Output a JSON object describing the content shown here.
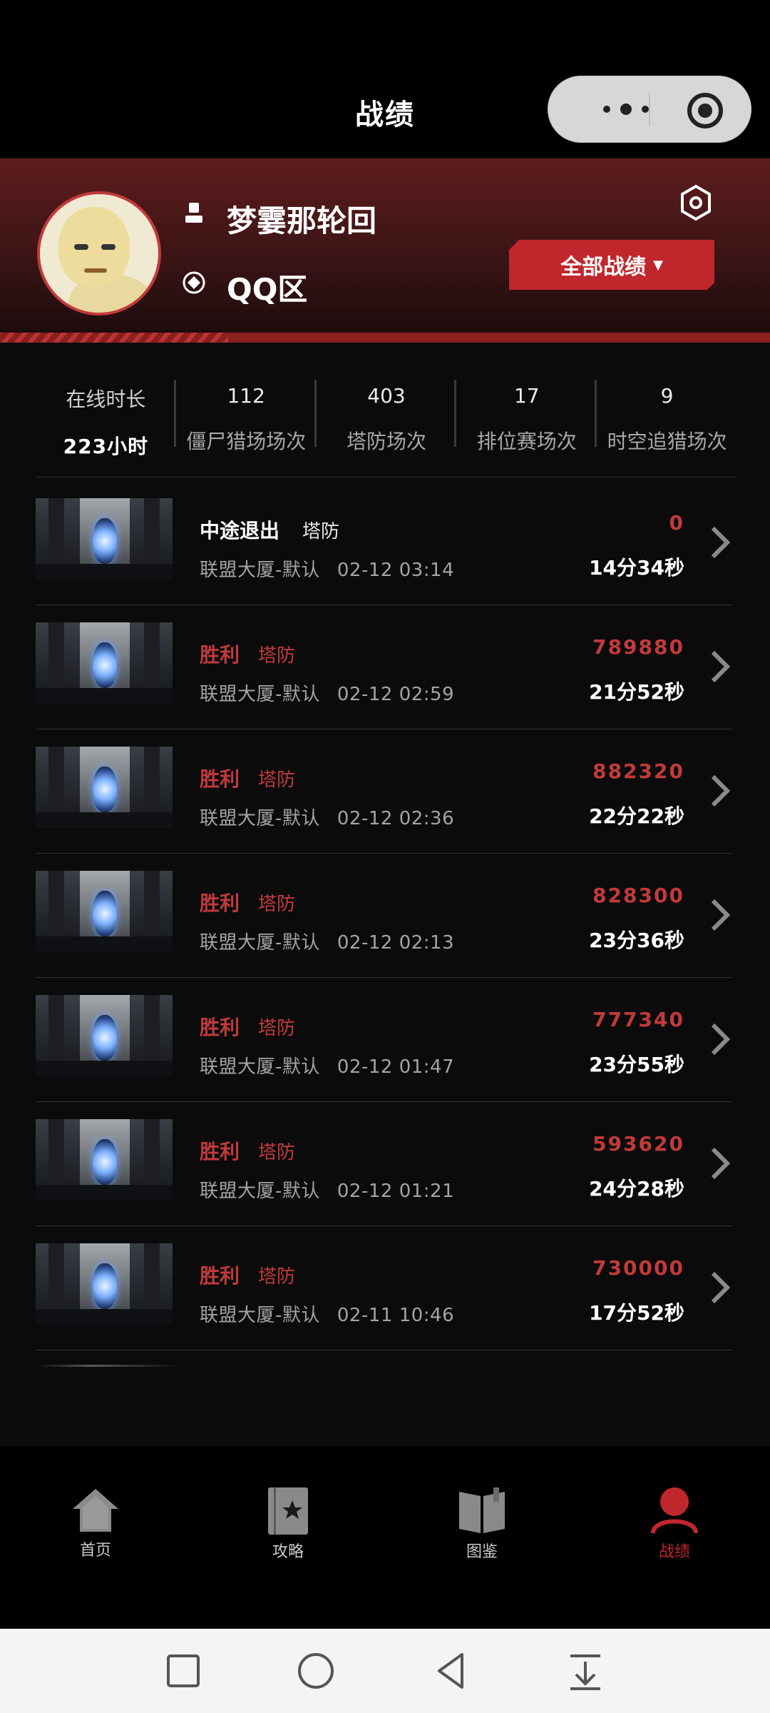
{
  "header": {
    "title": "战绩"
  },
  "profile": {
    "user_name": "梦霎那轮回",
    "server": "QQ区",
    "filter_button": "全部战绩",
    "filter_caret": "▼"
  },
  "stats": {
    "online": {
      "label": "在线时长",
      "value": "223小时"
    },
    "items": [
      {
        "value": "112",
        "label": "僵尸猎场场次"
      },
      {
        "value": "403",
        "label": "塔防场次"
      },
      {
        "value": "17",
        "label": "排位赛场次"
      },
      {
        "value": "9",
        "label": "时空追猎场次"
      }
    ]
  },
  "records": [
    {
      "result": "中途退出",
      "mode": "塔防",
      "map": "联盟大厦-默认",
      "time": "02-12 03:14",
      "score": "0",
      "duration": "14分34秒"
    },
    {
      "result": "胜利",
      "mode": "塔防",
      "map": "联盟大厦-默认",
      "time": "02-12 02:59",
      "score": "789880",
      "duration": "21分52秒"
    },
    {
      "result": "胜利",
      "mode": "塔防",
      "map": "联盟大厦-默认",
      "time": "02-12 02:36",
      "score": "882320",
      "duration": "22分22秒"
    },
    {
      "result": "胜利",
      "mode": "塔防",
      "map": "联盟大厦-默认",
      "time": "02-12 02:13",
      "score": "828300",
      "duration": "23分36秒"
    },
    {
      "result": "胜利",
      "mode": "塔防",
      "map": "联盟大厦-默认",
      "time": "02-12 01:47",
      "score": "777340",
      "duration": "23分55秒"
    },
    {
      "result": "胜利",
      "mode": "塔防",
      "map": "联盟大厦-默认",
      "time": "02-12 01:21",
      "score": "593620",
      "duration": "24分28秒"
    },
    {
      "result": "胜利",
      "mode": "塔防",
      "map": "联盟大厦-默认",
      "time": "02-11 10:46",
      "score": "730000",
      "duration": "17分52秒"
    }
  ],
  "nav": [
    {
      "label": "首页",
      "icon": "home-icon"
    },
    {
      "label": "攻略",
      "icon": "guide-icon"
    },
    {
      "label": "图鉴",
      "icon": "book-icon"
    },
    {
      "label": "战绩",
      "icon": "record-icon",
      "active": true
    }
  ],
  "colors": {
    "accent": "#c0272d",
    "background": "#0b0b0c",
    "win": "#c23a3a"
  }
}
